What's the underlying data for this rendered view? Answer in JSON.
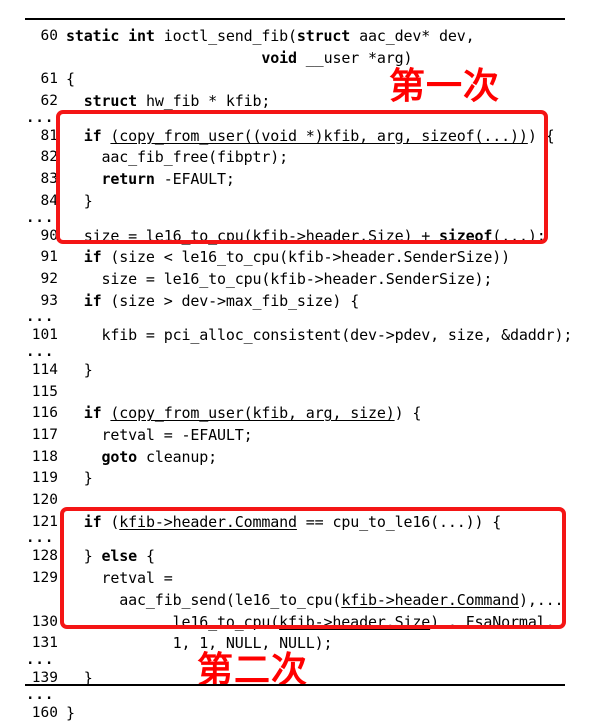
{
  "figure": {
    "kind": "source-code-listing",
    "language": "c",
    "function_name": "ioctl_send_fib",
    "accent_color": "#ff0000",
    "text_color": "#000000",
    "background_color": "#ffffff"
  },
  "annotations": [
    {
      "id": "first",
      "text": "第一次",
      "color": "#ff0000"
    },
    {
      "id": "second",
      "text": "第二次",
      "color": "#ff0000"
    }
  ],
  "highlight_boxes": [
    {
      "id": "first",
      "color": "#f41515",
      "covers_lines": "81-90"
    },
    {
      "id": "second",
      "color": "#f41515",
      "covers_lines": "128-139"
    }
  ],
  "lines": [
    {
      "num": "60",
      "code": "<b class=\"kw\">static int</b> ioctl_send_fib(<b class=\"kw\">struct</b> aac_dev* dev,"
    },
    {
      "num": "",
      "code": "                      <b class=\"kw\">void</b> __user *arg)"
    },
    {
      "num": "61",
      "code": "{"
    },
    {
      "num": "62",
      "code": "  <b class=\"kw\">struct</b> hw_fib * kfib;"
    },
    {
      "num": "...",
      "code": "",
      "ellipsis": true
    },
    {
      "num": "81",
      "code": "  <b class=\"kw\">if</b> <u class=\"ul\">(copy_from_user((void *)kfib, arg, sizeof(...))</u>) {"
    },
    {
      "num": "82",
      "code": "    aac_fib_free(fibptr);"
    },
    {
      "num": "83",
      "code": "    <b class=\"kw\">return</b> -EFAULT;"
    },
    {
      "num": "84",
      "code": "  }"
    },
    {
      "num": "...",
      "code": "",
      "ellipsis": true
    },
    {
      "num": "90",
      "code": "  size = le16_to_cpu(<u class=\"ul\">kfib-&gt;header.Size</u>) + <b class=\"kw\">sizeof</b>(...);"
    },
    {
      "num": "91",
      "code": "  <b class=\"kw\">if</b> (size &lt; le16_to_cpu(kfib-&gt;header.SenderSize))"
    },
    {
      "num": "92",
      "code": "    size = le16_to_cpu(kfib-&gt;header.SenderSize);"
    },
    {
      "num": "93",
      "code": "  <b class=\"kw\">if</b> (size &gt; dev-&gt;max_fib_size) {"
    },
    {
      "num": "...",
      "code": "",
      "ellipsis": true
    },
    {
      "num": "101",
      "code": "    kfib = pci_alloc_consistent(dev-&gt;pdev, size, &amp;daddr);"
    },
    {
      "num": "...",
      "code": "",
      "ellipsis": true
    },
    {
      "num": "114",
      "code": "  }"
    },
    {
      "num": "115",
      "code": ""
    },
    {
      "num": "116",
      "code": "  <b class=\"kw\">if</b> <u class=\"ul\">(copy_from_user(kfib, arg, size)</u>) {"
    },
    {
      "num": "117",
      "code": "    retval = -EFAULT;"
    },
    {
      "num": "118",
      "code": "    <b class=\"kw\">goto</b> cleanup;"
    },
    {
      "num": "119",
      "code": "  }"
    },
    {
      "num": "120",
      "code": ""
    },
    {
      "num": "121",
      "code": "  <b class=\"kw\">if</b> (<u class=\"ul\">kfib-&gt;header.Command</u> == cpu_to_le16(...)) {"
    },
    {
      "num": "...",
      "code": "",
      "ellipsis": true
    },
    {
      "num": "128",
      "code": "  } <b class=\"kw\">else</b> {"
    },
    {
      "num": "129",
      "code": "    retval ="
    },
    {
      "num": "",
      "code": "      aac_fib_send(le16_to_cpu(<u class=\"ul\">kfib-&gt;header.Command</u>),..."
    },
    {
      "num": "130",
      "code": "            le16_to_cpu(<u class=\"ul\">kfib-&gt;header.Size</u>) , FsaNormal,"
    },
    {
      "num": "131",
      "code": "            1, 1, NULL, NULL);"
    },
    {
      "num": "...",
      "code": "",
      "ellipsis": true
    },
    {
      "num": "139",
      "code": "  }"
    },
    {
      "num": "...",
      "code": "",
      "ellipsis": true
    },
    {
      "num": "160",
      "code": "}"
    }
  ]
}
